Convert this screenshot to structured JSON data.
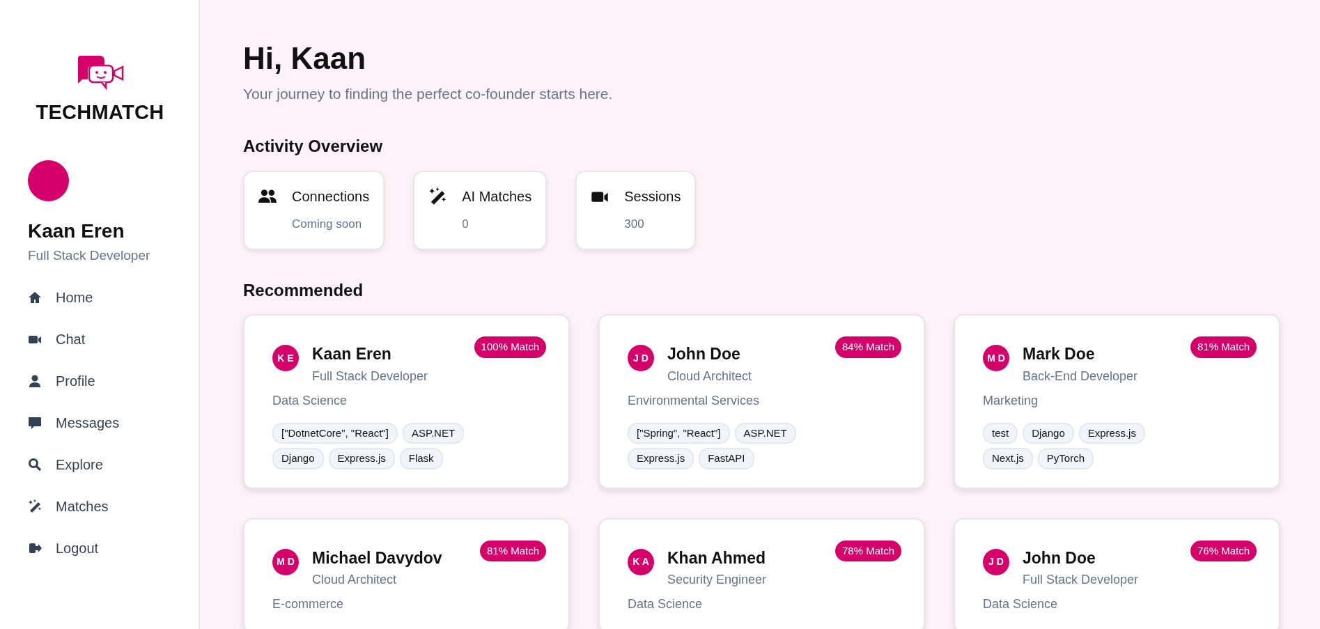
{
  "brand": {
    "name": "TECHMATCH"
  },
  "user": {
    "name": "Kaan Eren",
    "role": "Full Stack Developer"
  },
  "nav": [
    {
      "label": "Home"
    },
    {
      "label": "Chat"
    },
    {
      "label": "Profile"
    },
    {
      "label": "Messages"
    },
    {
      "label": "Explore"
    },
    {
      "label": "Matches"
    },
    {
      "label": "Logout"
    }
  ],
  "greeting": {
    "title": "Hi, Kaan",
    "subtitle": "Your journey to finding the perfect co-founder starts here."
  },
  "activity": {
    "title": "Activity Overview",
    "stats": [
      {
        "label": "Connections",
        "value": "Coming soon"
      },
      {
        "label": "AI Matches",
        "value": "0"
      },
      {
        "label": "Sessions",
        "value": "300"
      }
    ]
  },
  "recommended": {
    "title": "Recommended",
    "cards": [
      {
        "initials": "K E",
        "name": "Kaan Eren",
        "role": "Full Stack Developer",
        "match": "100% Match",
        "industry": "Data Science",
        "tags": [
          "[\"DotnetCore\", \"React\"]",
          "ASP.NET",
          "Django",
          "Express.js",
          "Flask"
        ]
      },
      {
        "initials": "J D",
        "name": "John Doe",
        "role": "Cloud Architect",
        "match": "84% Match",
        "industry": "Environmental Services",
        "tags": [
          "[\"Spring\", \"React\"]",
          "ASP.NET",
          "Express.js",
          "FastAPI"
        ]
      },
      {
        "initials": "M D",
        "name": "Mark Doe",
        "role": "Back-End Developer",
        "match": "81% Match",
        "industry": "Marketing",
        "tags": [
          "test",
          "Django",
          "Express.js",
          "Next.js",
          "PyTorch"
        ]
      },
      {
        "initials": "M D",
        "name": "Michael Davydov",
        "role": "Cloud Architect",
        "match": "81% Match",
        "industry": "E-commerce"
      },
      {
        "initials": "K A",
        "name": "Khan Ahmed",
        "role": "Security Engineer",
        "match": "78% Match",
        "industry": "Data Science"
      },
      {
        "initials": "J D",
        "name": "John Doe",
        "role": "Full Stack Developer",
        "match": "76% Match",
        "industry": "Data Science"
      }
    ]
  }
}
